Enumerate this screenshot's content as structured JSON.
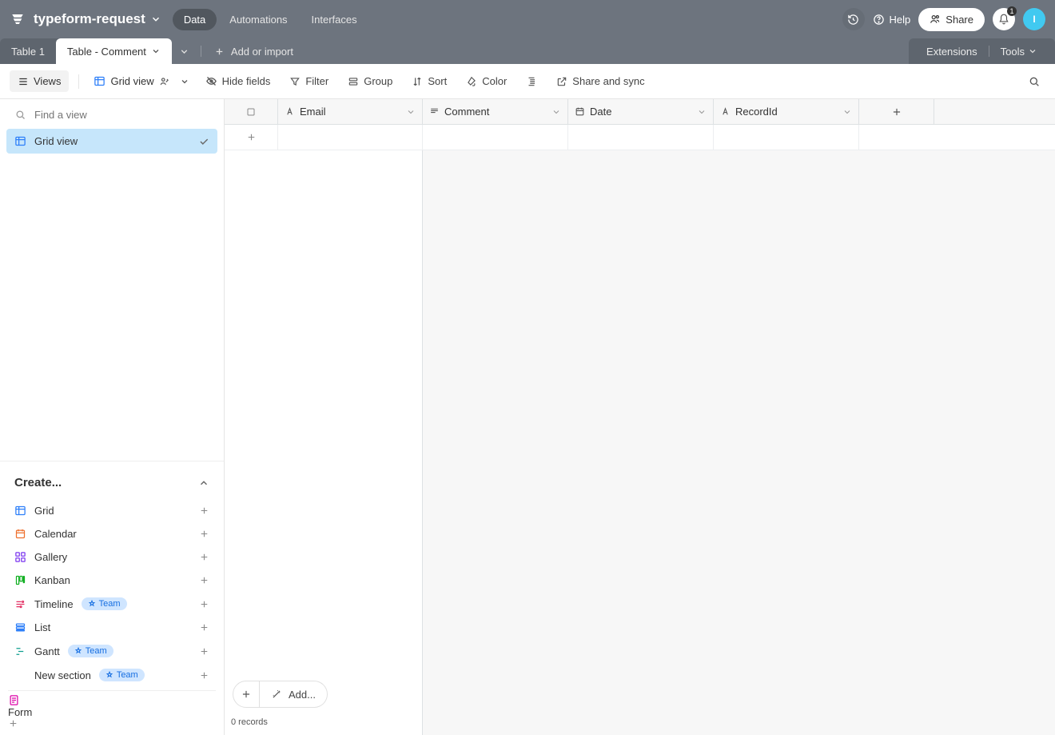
{
  "header": {
    "baseName": "typeform-request",
    "tabs": [
      "Data",
      "Automations",
      "Interfaces"
    ],
    "activeTab": 0,
    "help": "Help",
    "share": "Share",
    "notifCount": "1",
    "avatarInitial": "I"
  },
  "tableTabs": {
    "tabs": [
      "Table 1",
      "Table - Comment"
    ],
    "activeTab": 1,
    "addOrImport": "Add or import",
    "extensions": "Extensions",
    "tools": "Tools"
  },
  "toolbar": {
    "views": "Views",
    "viewName": "Grid view",
    "hideFields": "Hide fields",
    "filter": "Filter",
    "group": "Group",
    "sort": "Sort",
    "color": "Color",
    "shareSync": "Share and sync"
  },
  "sidebar": {
    "findPlaceholder": "Find a view",
    "views": [
      {
        "label": "Grid view",
        "active": true
      }
    ],
    "createHeader": "Create...",
    "createItems": [
      {
        "label": "Grid",
        "icon": "grid",
        "color": "#2d7ff9",
        "team": false
      },
      {
        "label": "Calendar",
        "icon": "calendar",
        "color": "#ee702e",
        "team": false
      },
      {
        "label": "Gallery",
        "icon": "gallery",
        "color": "#7c37ef",
        "team": false
      },
      {
        "label": "Kanban",
        "icon": "kanban",
        "color": "#11af22",
        "team": false
      },
      {
        "label": "Timeline",
        "icon": "timeline",
        "color": "#e22e62",
        "team": true
      },
      {
        "label": "List",
        "icon": "list",
        "color": "#2d7ff9",
        "team": false
      },
      {
        "label": "Gantt",
        "icon": "gantt",
        "color": "#0f9f8f",
        "team": true
      },
      {
        "label": "New section",
        "icon": "none",
        "color": "#333",
        "team": true
      }
    ],
    "teamBadge": "Team",
    "formItem": {
      "label": "Form",
      "color": "#dd04a8"
    }
  },
  "columns": [
    {
      "label": "Email",
      "icon": "text"
    },
    {
      "label": "Comment",
      "icon": "longtext"
    },
    {
      "label": "Date",
      "icon": "date"
    },
    {
      "label": "RecordId",
      "icon": "text"
    }
  ],
  "footer": {
    "addMenu": "Add...",
    "records": "0 records"
  }
}
